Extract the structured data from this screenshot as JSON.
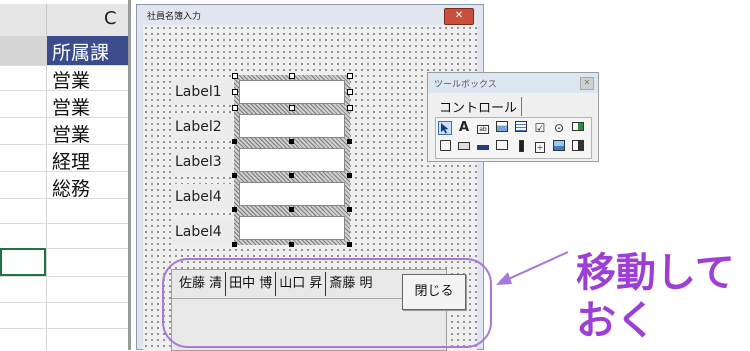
{
  "sheet": {
    "column_header": "C",
    "cells": [
      "所属課",
      "営業",
      "営業",
      "営業",
      "経理",
      "総務"
    ]
  },
  "form": {
    "title": "社員名簿入力",
    "close_glyph": "✕",
    "labels": [
      "Label1",
      "Label2",
      "Label3",
      "Label4",
      "Label4"
    ],
    "tabs": [
      "佐藤 清",
      "田中 博",
      "山口 昇",
      "斎藤 明"
    ],
    "close_button": "閉じる"
  },
  "toolbox": {
    "title": "ツールボックス",
    "tab": "コントロール",
    "close_glyph": "✕"
  },
  "annotation": {
    "line1": "移動して",
    "line2": "おく"
  },
  "colors": {
    "annotation": "#9d3fd6",
    "selection": "#3a4c8c"
  }
}
